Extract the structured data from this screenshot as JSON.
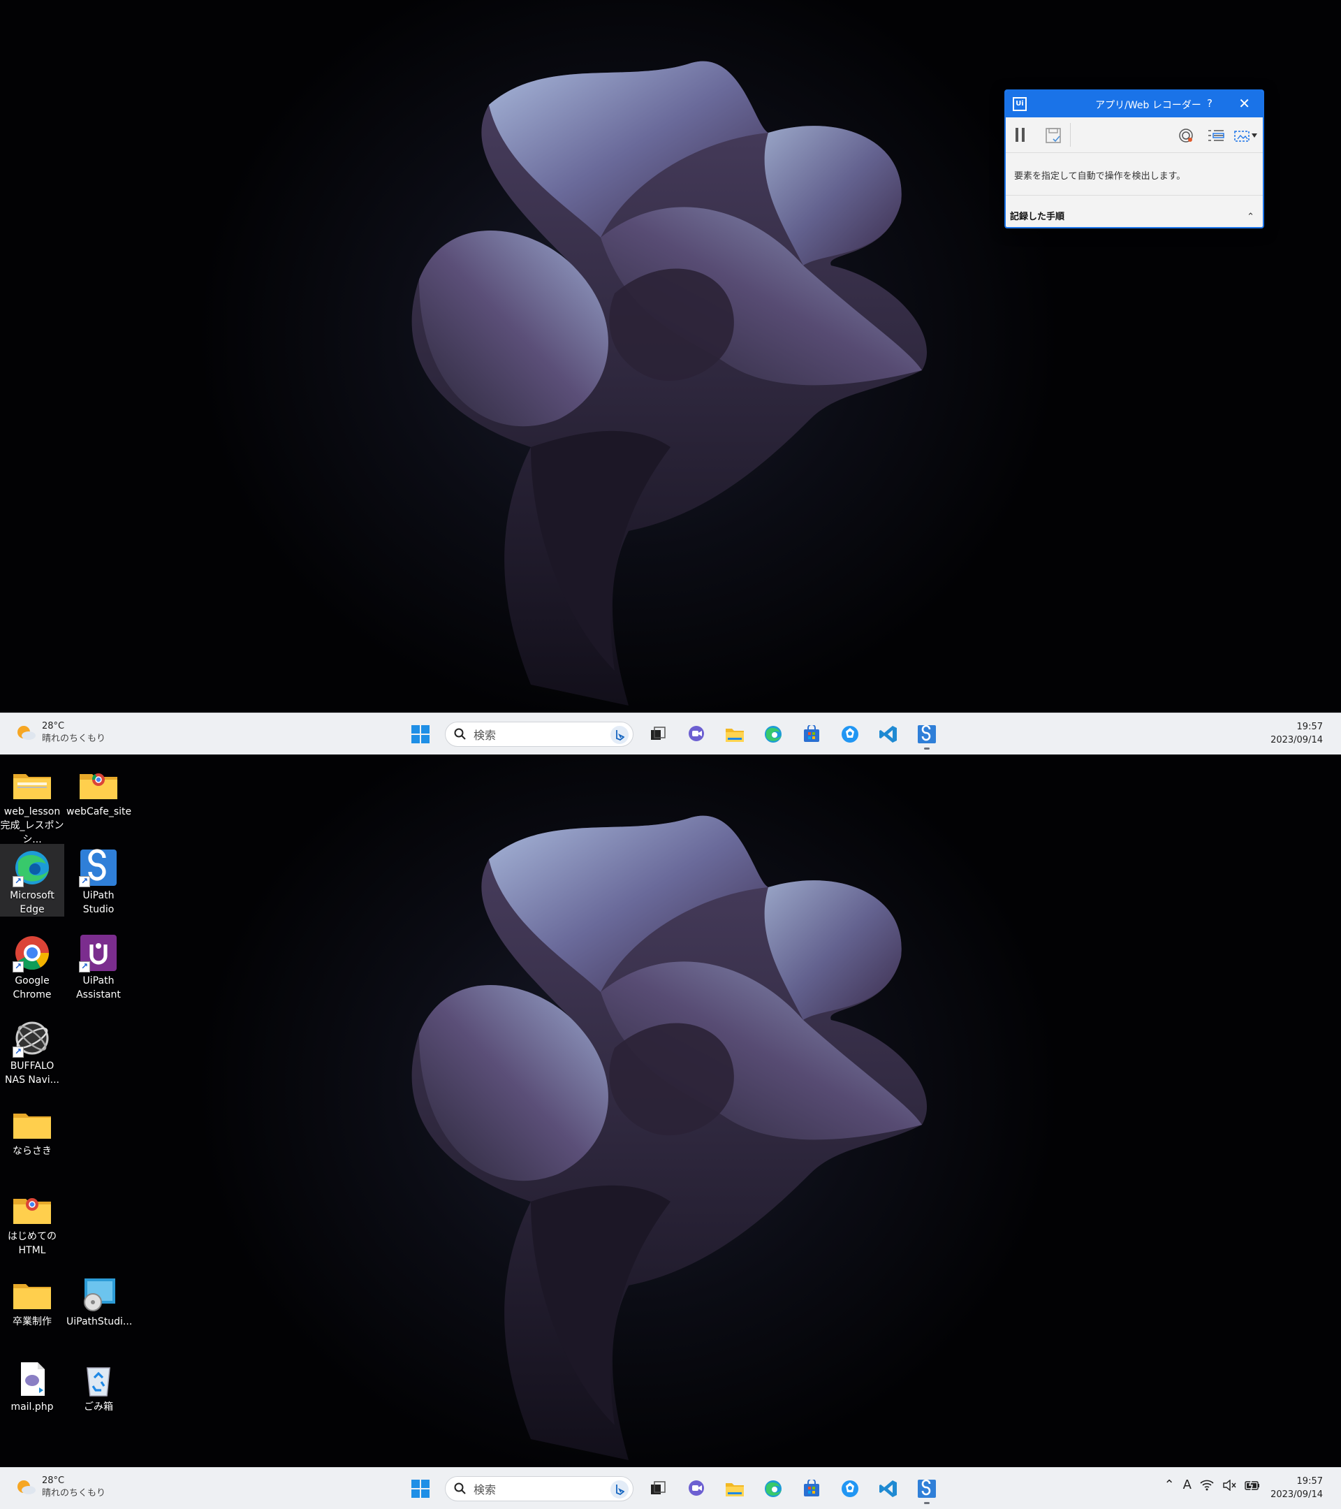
{
  "screens": [
    {
      "recorder": {
        "title": "アプリ/Web レコーダー",
        "logo": "Ui",
        "help": "?",
        "close": "✕",
        "message": "要素を指定して自動で操作を検出します。",
        "section_label": "記録した手順",
        "chevron": "⌃"
      },
      "taskbar": {
        "weather_temp": "28°C",
        "weather_desc": "晴れのちくもり",
        "search_placeholder": "検索",
        "time": "19:57",
        "date": "2023/09/14"
      }
    },
    {
      "desktop_icons": [
        {
          "label": "web_lesson完成_レスポンシ...",
          "icon": "folder-zip-icon"
        },
        {
          "label": "webCafe_site",
          "icon": "chrome-folder-icon"
        },
        {
          "label": "Microsoft Edge",
          "icon": "edge-icon"
        },
        {
          "label": "UiPath Studio",
          "icon": "uipath-studio-icon"
        },
        {
          "label": "Google Chrome",
          "icon": "chrome-icon"
        },
        {
          "label": "UiPath Assistant",
          "icon": "uipath-assistant-icon"
        },
        {
          "label": "BUFFALO NAS Navi...",
          "icon": "buffalo-nas-icon"
        },
        {
          "label": "ならさき",
          "icon": "folder-icon"
        },
        {
          "label": "はじめてのHTML",
          "icon": "chrome-folder-icon"
        },
        {
          "label": "卒業制作",
          "icon": "folder-icon"
        },
        {
          "label": "UiPathStudi...",
          "icon": "installer-icon"
        },
        {
          "label": "mail.php",
          "icon": "php-file-icon"
        },
        {
          "label": "ごみ箱",
          "icon": "recycle-bin-icon"
        }
      ],
      "taskbar": {
        "weather_temp": "28°C",
        "weather_desc": "晴れのちくもり",
        "search_placeholder": "検索",
        "tray_ime": "A",
        "time": "19:57",
        "date": "2023/09/14"
      }
    }
  ],
  "colors": {
    "accent": "#1a73e8",
    "taskbar_bg": "#eef0f3",
    "wallpaper_bg": "#05060a"
  }
}
